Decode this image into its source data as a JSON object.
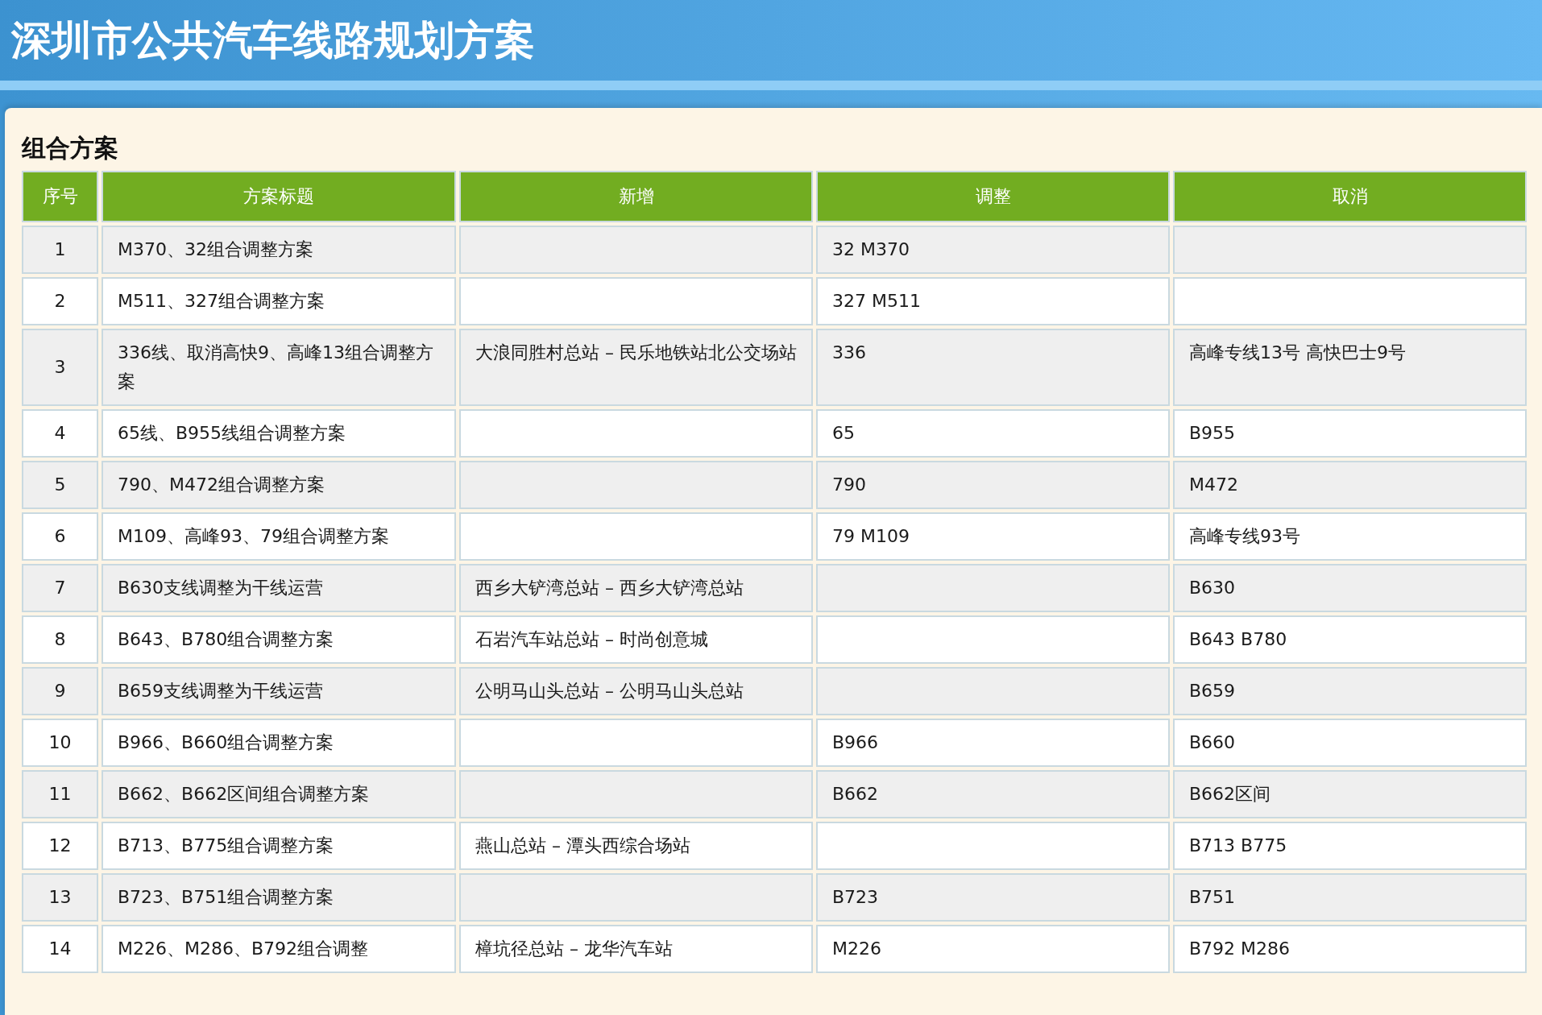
{
  "page_title": "深圳市公共汽车线路规划方案",
  "section_title": "组合方案",
  "table": {
    "columns": [
      "序号",
      "方案标题",
      "新增",
      "调整",
      "取消"
    ],
    "rows": [
      {
        "no": "1",
        "title": "M370、32组合调整方案",
        "adjusted": "32 M370"
      },
      {
        "no": "2",
        "title": "M511、327组合调整方案",
        "adjusted": "327 M511"
      },
      {
        "no": "3",
        "title": "336线、取消高快9、高峰13组合调整方案",
        "added": "大浪同胜村总站 – 民乐地铁站北公交场站",
        "adjusted": "336",
        "cancelled": "高峰专线13号 高快巴士9号"
      },
      {
        "no": "4",
        "title": "65线、B955线组合调整方案",
        "adjusted": "65",
        "cancelled": "B955"
      },
      {
        "no": "5",
        "title": "790、M472组合调整方案",
        "adjusted": "790",
        "cancelled": "M472"
      },
      {
        "no": "6",
        "title": "M109、高峰93、79组合调整方案",
        "adjusted": "79 M109",
        "cancelled": "高峰专线93号"
      },
      {
        "no": "7",
        "title": "B630支线调整为干线运营",
        "added": "西乡大铲湾总站 – 西乡大铲湾总站",
        "cancelled": "B630"
      },
      {
        "no": "8",
        "title": "B643、B780组合调整方案",
        "added": "石岩汽车站总站 – 时尚创意城",
        "cancelled": "B643 B780"
      },
      {
        "no": "9",
        "title": "B659支线调整为干线运营",
        "added": "公明马山头总站 – 公明马山头总站",
        "cancelled": "B659"
      },
      {
        "no": "10",
        "title": "B966、B660组合调整方案",
        "adjusted": "B966",
        "cancelled": "B660"
      },
      {
        "no": "11",
        "title": "B662、B662区间组合调整方案",
        "adjusted": "B662",
        "cancelled": "B662区间"
      },
      {
        "no": "12",
        "title": "B713、B775组合调整方案",
        "added": "燕山总站 – 潭头西综合场站",
        "cancelled": "B713 B775"
      },
      {
        "no": "13",
        "title": "B723、B751组合调整方案",
        "adjusted": "B723",
        "cancelled": "B751"
      },
      {
        "no": "14",
        "title": "M226、M286、B792组合调整",
        "added": "樟坑径总站 – 龙华汽车站",
        "adjusted": "M226",
        "cancelled": "B792 M286"
      }
    ]
  }
}
